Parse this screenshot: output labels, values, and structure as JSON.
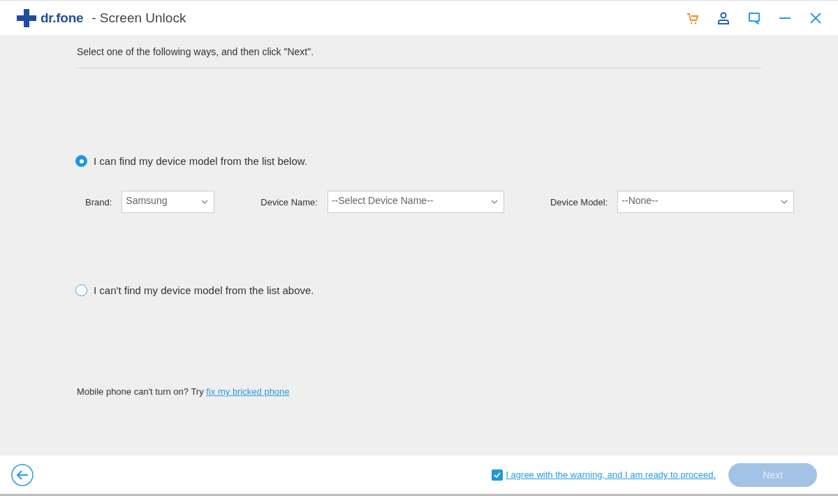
{
  "window": {
    "logo": "dr.fone",
    "title": "- Screen Unlock"
  },
  "instruction": "Select one of the following ways, and then click \"Next\".",
  "options": [
    {
      "label": "I can find my device model from the list below.",
      "selected": true
    },
    {
      "label": "I can't find my device model from the list above.",
      "selected": false
    }
  ],
  "selects": [
    {
      "label": "Brand:",
      "value": "Samsung"
    },
    {
      "label": "Device Name:",
      "value": "--Select Device Name--"
    },
    {
      "label": "Device Model:",
      "value": "--None--"
    }
  ],
  "hint": {
    "text": "Mobile phone can't turn on? Try",
    "link": "fix my bricked phone"
  },
  "footer": {
    "agree": {
      "label": "I agree with the warning, and I am ready to proceed.",
      "checked": true
    },
    "next": {
      "label": "Next",
      "disabled": true
    }
  }
}
